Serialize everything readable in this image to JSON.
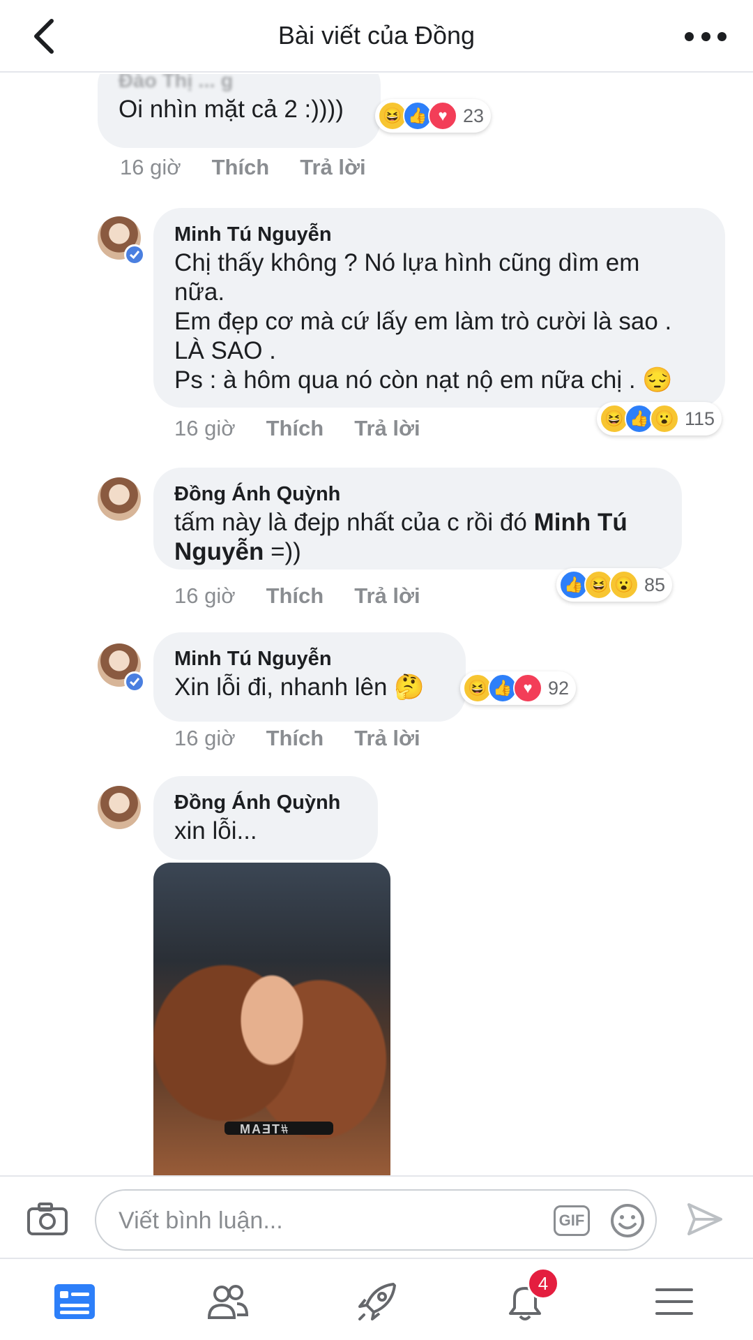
{
  "header": {
    "title": "Bài viết của Đồng"
  },
  "comments": [
    {
      "author": "Đào Thị ... g",
      "text": "Oi nhìn mặt cả 2 :))))",
      "time": "16 giờ",
      "like_label": "Thích",
      "reply_label": "Trả lời",
      "reactions": [
        "haha",
        "like",
        "love"
      ],
      "reaction_count": "23"
    },
    {
      "author": "Minh Tú Nguyễn",
      "verified": true,
      "lines": [
        "Chị thấy không ? Nó lựa hình cũng dìm em",
        "nữa.",
        "Em đẹp cơ mà cứ lấy em làm trò cười là sao  .",
        "LÀ SAO .",
        "Ps : à hôm qua nó còn nạt nộ em nữa chị .",
        "😔"
      ],
      "time": "16 giờ",
      "like_label": "Thích",
      "reply_label": "Trả lời",
      "reactions": [
        "haha",
        "like",
        "wow"
      ],
      "reaction_count": "115"
    },
    {
      "author": "Đồng Ánh Quỳnh",
      "text_before": "tấm này là đejp nhất của c rồi đó ",
      "mention_1": "Minh Tú",
      "mention_2": "Nguyễn",
      "text_after": " =))",
      "time": "16 giờ",
      "like_label": "Thích",
      "reply_label": "Trả lời",
      "reactions": [
        "like",
        "haha",
        "wow"
      ],
      "reaction_count": "85"
    },
    {
      "author": "Minh Tú Nguyễn",
      "verified": true,
      "text": "Xin lỗi đi, nhanh lên",
      "emoji": "🤔",
      "time": "16 giờ",
      "like_label": "Thích",
      "reply_label": "Trả lời",
      "reactions": [
        "haha",
        "like",
        "love"
      ],
      "reaction_count": "92"
    },
    {
      "author": "Đồng Ánh Quỳnh",
      "text": "xin lỗi...",
      "photo_text": "#TEAM"
    }
  ],
  "composer": {
    "placeholder": "Viết bình luận...",
    "gif_label": "GIF"
  },
  "tabbar": {
    "notifications_badge": "4"
  },
  "icons": {
    "back": "chevron-left-icon",
    "more": "more-dots-icon",
    "camera": "camera-icon",
    "gif": "gif-icon",
    "emoji": "emoji-icon",
    "send": "send-icon",
    "feed": "news-feed-icon",
    "friends": "friends-icon",
    "explore": "rocket-icon",
    "notifications": "bell-icon",
    "menu": "menu-icon"
  },
  "colors": {
    "accent": "#2d7ff9",
    "bubble": "#f0f2f5",
    "meta": "#8a8d91",
    "badge": "#e41e3f"
  }
}
